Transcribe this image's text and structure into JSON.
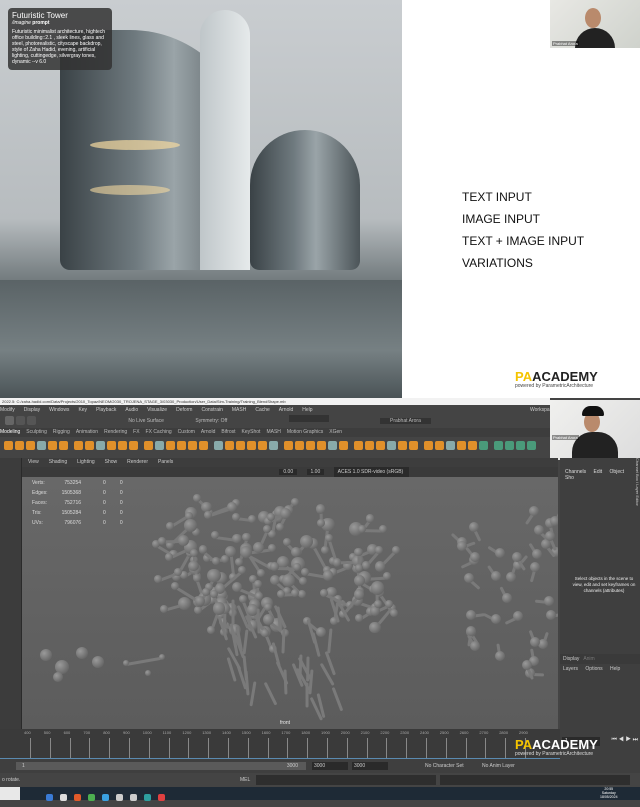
{
  "slide": {
    "prompt_card": {
      "title": "Futuristic Tower",
      "command": "/imagine",
      "command_bold": "prompt",
      "text": "Futuristic minimalist architecture, hightech office building::2.1 , sleek lines, glass and steel, photorealistic, cityscape backdrop, style of Zaha Hadid, evening, artificial lighting, cuttingedge, silvergray tones, dynamic --v 6.0"
    },
    "input_types": [
      "TEXT INPUT",
      "IMAGE INPUT",
      "TEXT + IMAGE INPUT",
      "VARIATIONS"
    ],
    "webcam_name": "Prabhat Arora",
    "logo": {
      "pa": "PA",
      "rest": "ACADEMY",
      "tagline": "powered by ParametricArchitecture"
    }
  },
  "maya": {
    "file_path": "2022.5: C:/zaha-hadid.com/Data/Projects/2010_Topaz/NEOM/2030_TROJENA_STAGE_3/03030_Production/User_Data/Sim-Training/Training_BlendShape.mb",
    "menu": [
      "Modify",
      "Display",
      "Windows",
      "Key",
      "Playback",
      "Audio",
      "Visualize",
      "Deform",
      "Constrain",
      "MASH",
      "Cache",
      "Arnold",
      "Help"
    ],
    "workspace_label": "Workspa",
    "status_line": {
      "live_surface": "No Live Surface",
      "symmetry": "Symmetry: Off",
      "user": "Prabhat Arora"
    },
    "shelf_tabs": [
      "Modeling",
      "Sculpting",
      "Rigging",
      "Animation",
      "Rendering",
      "FX",
      "FX Caching",
      "Custom",
      "Arnold",
      "Bifrost",
      "KeyShot",
      "MASH",
      "Motion Graphics",
      "XGen"
    ],
    "panel_menu": [
      "View",
      "Shading",
      "Lighting",
      "Show",
      "Renderer",
      "Panels"
    ],
    "viewport_toolbar": {
      "exposure": "0.00",
      "gamma": "1.00",
      "color_space": "ACES 1.0 SDR-video (sRGB)"
    },
    "hud": [
      {
        "label": "Verts:",
        "value": "753254",
        "a": "0",
        "b": "0"
      },
      {
        "label": "Edges:",
        "value": "1505368",
        "a": "0",
        "b": "0"
      },
      {
        "label": "Faces:",
        "value": "752716",
        "a": "0",
        "b": "0"
      },
      {
        "label": "Tris:",
        "value": "1505284",
        "a": "0",
        "b": "0"
      },
      {
        "label": "UVs:",
        "value": "796076",
        "a": "0",
        "b": "0"
      }
    ],
    "camera_label": "front",
    "channel_box": {
      "tabs": [
        "Channels",
        "Edit",
        "Object",
        "Sho"
      ],
      "message": "Select objects in the scene to view, edit and set keyframes on channels (attributes)",
      "side_tabs": "Channel Box / Layer Editor",
      "display_label": "Display",
      "anim_label": "Anim",
      "layer_menu": [
        "Layers",
        "Options",
        "Help"
      ]
    },
    "timeline_ticks": [
      "400",
      "500",
      "600",
      "700",
      "800",
      "900",
      "1000",
      "1100",
      "1200",
      "1300",
      "1400",
      "1500",
      "1600",
      "1700",
      "1800",
      "1900",
      "2000",
      "2100",
      "2200",
      "2300",
      "2400",
      "2500",
      "2600",
      "2700",
      "2800",
      "2900"
    ],
    "current_frame": "1",
    "range": {
      "start": "1",
      "end_inner": "3000",
      "end": "3000",
      "end2": "3000",
      "character_set": "No Character Set",
      "anim_layer": "No Anim Layer"
    },
    "command_label": "MEL",
    "help_text": "o rotate.",
    "webcam_name": "Prabhat Arora",
    "logo": {
      "pa": "PA",
      "rest": "ACADEMY",
      "tagline": "powered by ParametricArchitecture"
    },
    "taskbar": {
      "time": "20:55",
      "day": "Saturday",
      "date": "18/05/2024"
    }
  },
  "colors": {
    "maya_accent": "#e0902a",
    "logo_yellow": "#f5c400",
    "timeline_blue": "#5a8ab0"
  }
}
